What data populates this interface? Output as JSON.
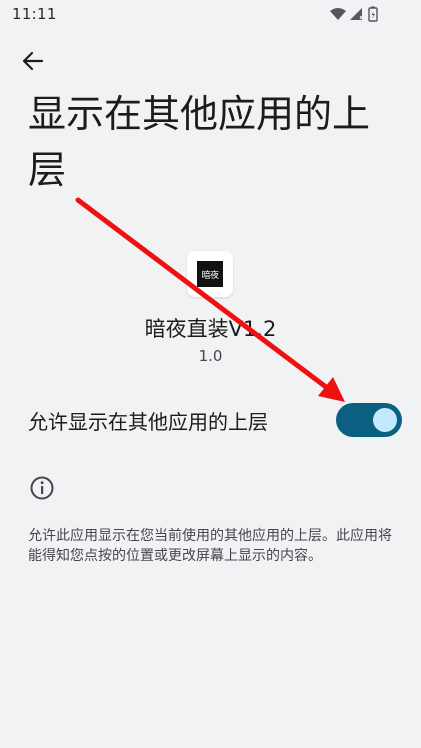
{
  "status_bar": {
    "time": "11:11",
    "icons": [
      "wifi-icon",
      "signal-icon",
      "battery-icon"
    ]
  },
  "header": {
    "back_icon": "arrow-left-icon",
    "title": "显示在其他应用的上层"
  },
  "app": {
    "icon_text": "暗夜",
    "name": "暗夜直装V1.2",
    "version": "1.0"
  },
  "permission": {
    "label": "允许显示在其他应用的上层",
    "enabled": true
  },
  "info": {
    "icon": "info-icon",
    "description": "允许此应用显示在您当前使用的其他应用的上层。此应用将能得知您点按的位置或更改屏幕上显示的内容。"
  },
  "colors": {
    "background": "#f1f2f4",
    "toggle_track": "#0b5f80",
    "toggle_thumb": "#c4e9ff",
    "annotation_arrow": "#ee1111"
  }
}
